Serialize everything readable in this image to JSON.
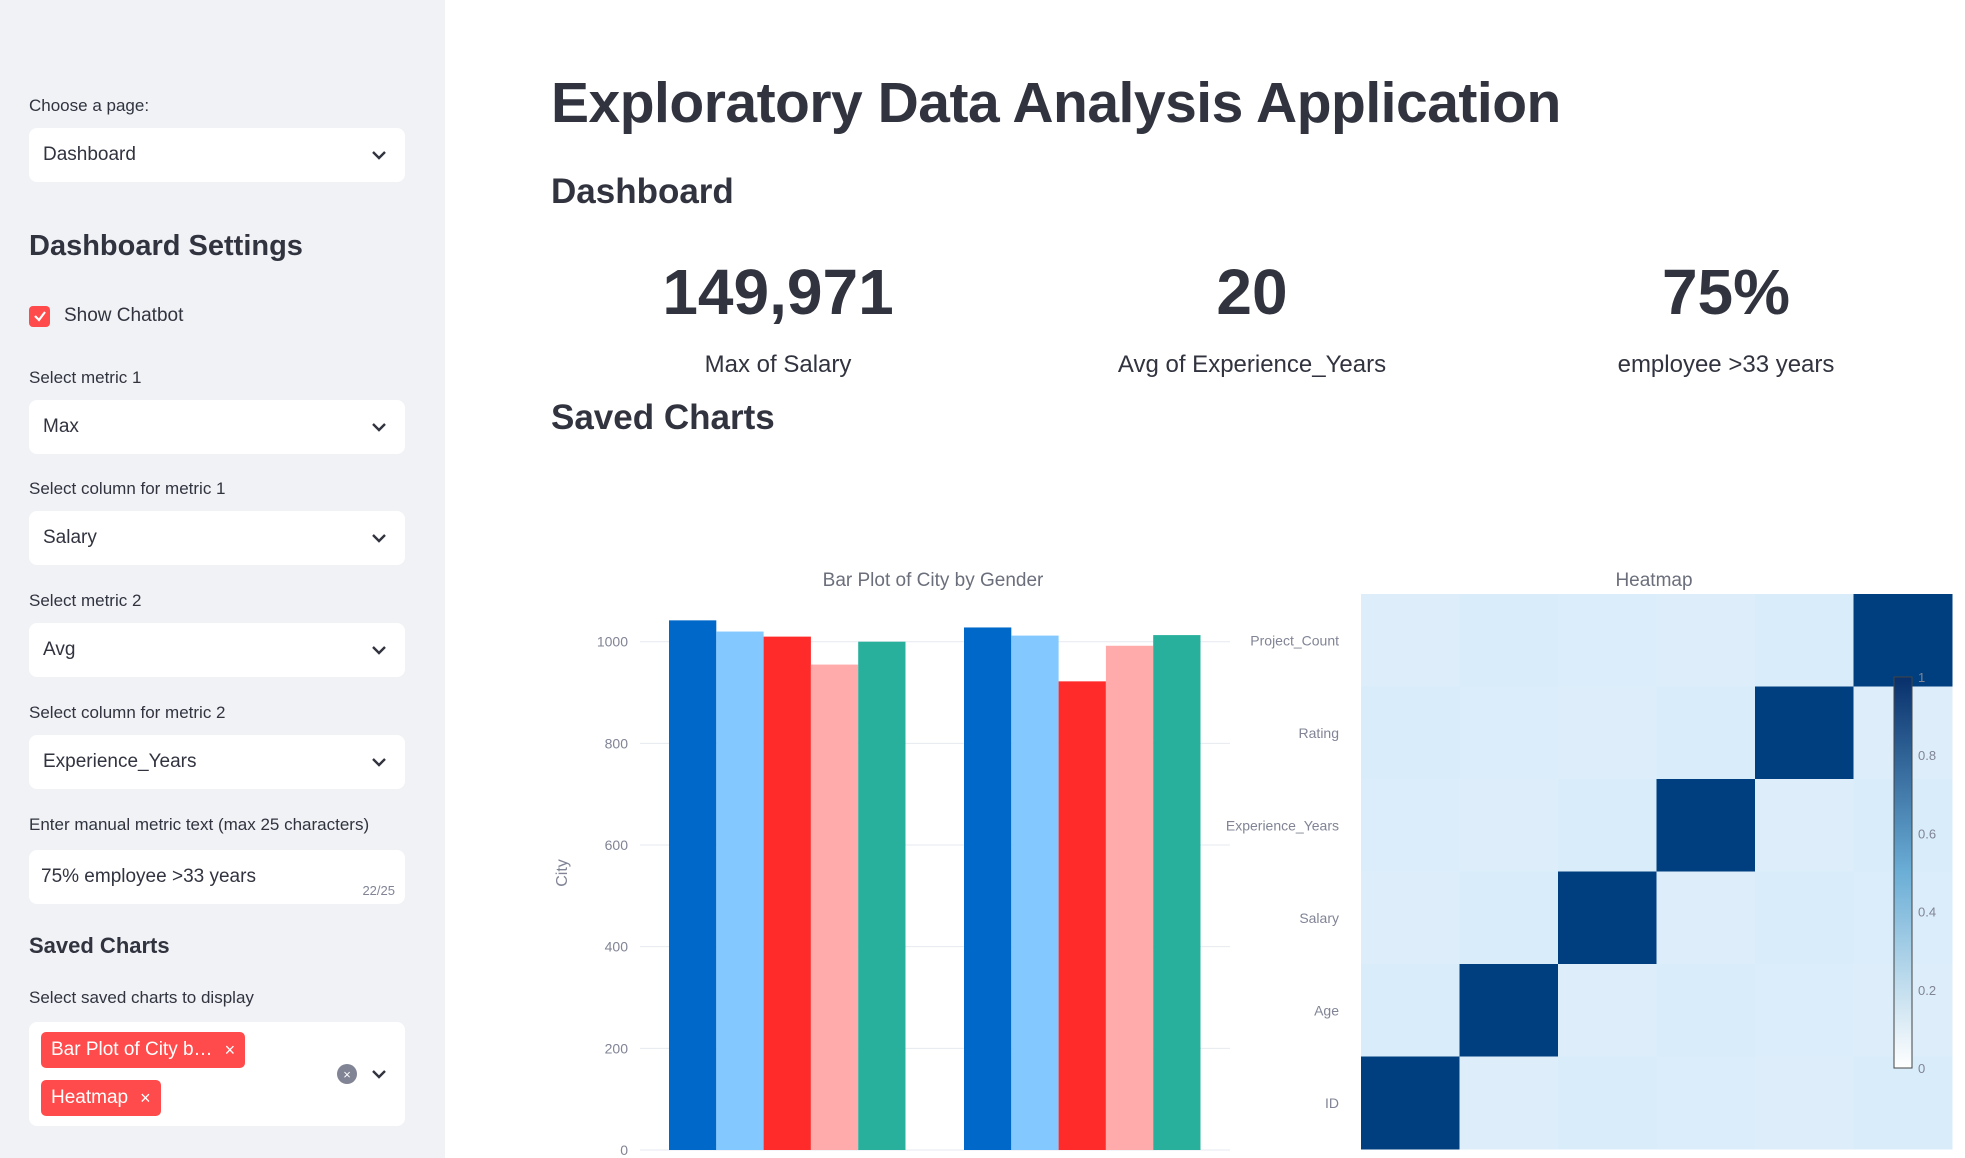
{
  "sidebar": {
    "page_label": "Choose a page:",
    "page_value": "Dashboard",
    "settings_title": "Dashboard Settings",
    "show_chatbot_label": "Show Chatbot",
    "metric1_label": "Select metric 1",
    "metric1_value": "Max",
    "column1_label": "Select column for metric 1",
    "column1_value": "Salary",
    "metric2_label": "Select metric 2",
    "metric2_value": "Avg",
    "column2_label": "Select column for metric 2",
    "column2_value": "Experience_Years",
    "manual_label": "Enter manual metric text (max 25 characters)",
    "manual_value": "75% employee >33 years",
    "manual_count": "22/25",
    "saved_title": "Saved Charts",
    "saved_label": "Select saved charts to display",
    "saved_tags": [
      "Bar Plot of City b…",
      "Heatmap"
    ]
  },
  "main": {
    "title": "Exploratory Data Analysis Application",
    "subtitle": "Dashboard",
    "metrics": [
      {
        "value": "149,971",
        "label": "Max of Salary"
      },
      {
        "value": "20",
        "label": "Avg of Experience_Years"
      },
      {
        "value": "75%",
        "label": "employee >33 years"
      }
    ],
    "saved_charts_title": "Saved Charts"
  },
  "colors": {
    "accent": "#ff4b4b",
    "sidebar_bg": "#f0f2f6",
    "series": [
      "#0068c9",
      "#83c9ff",
      "#ff2b2b",
      "#ffabab",
      "#29b09d"
    ]
  },
  "chart_data": [
    {
      "type": "bar",
      "title": "Bar Plot of City by Gender",
      "ylabel": "City",
      "ylim": [
        0,
        1050
      ],
      "yticks": [
        0,
        200,
        400,
        600,
        800,
        1000
      ],
      "groups": [
        [
          1042,
          1020,
          1010,
          955,
          1000
        ],
        [
          1028,
          1012,
          922,
          992,
          1013
        ]
      ]
    },
    {
      "type": "heatmap",
      "title": "Heatmap",
      "row_labels": [
        "Project_Count",
        "Rating",
        "Experience_Years",
        "Salary",
        "Age",
        "ID"
      ],
      "colorbar_ticks": [
        "1",
        "0.8",
        "0.6",
        "0.4",
        "0.2",
        "0"
      ],
      "diagonal_value": 1,
      "off_diagonal_value": 0.05
    }
  ]
}
